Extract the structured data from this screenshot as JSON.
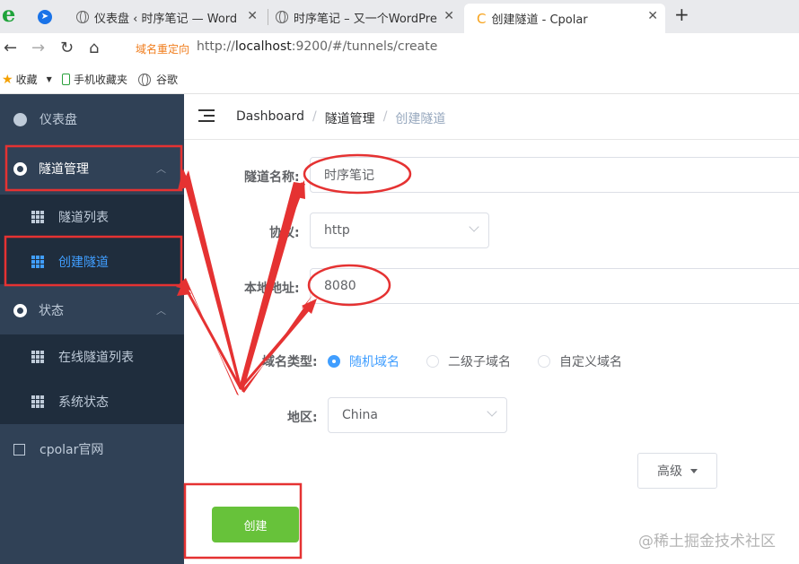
{
  "browser": {
    "tabs": [
      {
        "title": "仪表盘 ‹ 时序笔记 — WordPr"
      },
      {
        "title": "时序笔记 – 又一个WordPress"
      },
      {
        "title": "创建隧道 - Cpolar"
      }
    ],
    "new_tab": "+",
    "close": "✕",
    "redirect_label": "域名重定向",
    "url_prefix": "http://",
    "url_host": "localhost",
    "url_rest": ":9200/#/tunnels/create",
    "bookmarks": {
      "favorites": "收藏",
      "mobile": "手机收藏夹",
      "google": "谷歌"
    }
  },
  "sidebar": {
    "dashboard": "仪表盘",
    "tunnel_mgmt": "隧道管理",
    "tunnel_list": "隧道列表",
    "create_tunnel": "创建隧道",
    "status": "状态",
    "online_list": "在线隧道列表",
    "system_status": "系统状态",
    "cpolar_site": "cpolar官网"
  },
  "breadcrumb": {
    "root": "Dashboard",
    "parent": "隧道管理",
    "current": "创建隧道",
    "sep": "/"
  },
  "form": {
    "name_label": "隧道名称:",
    "name_value": "时序笔记",
    "protocol_label": "协议:",
    "protocol_value": "http",
    "local_label": "本地地址:",
    "local_value": "8080",
    "domain_type_label": "域名类型:",
    "domain_options": [
      "随机域名",
      "二级子域名",
      "自定义域名"
    ],
    "region_label": "地区:",
    "region_value": "China",
    "advanced": "高级",
    "create": "创建"
  },
  "watermark": "@稀土掘金技术社区",
  "colors": {
    "sidebar_bg": "#304156",
    "submenu_bg": "#1f2d3d",
    "accent": "#409eff",
    "create_green": "#67c23a",
    "annotation_red": "#e53232"
  }
}
